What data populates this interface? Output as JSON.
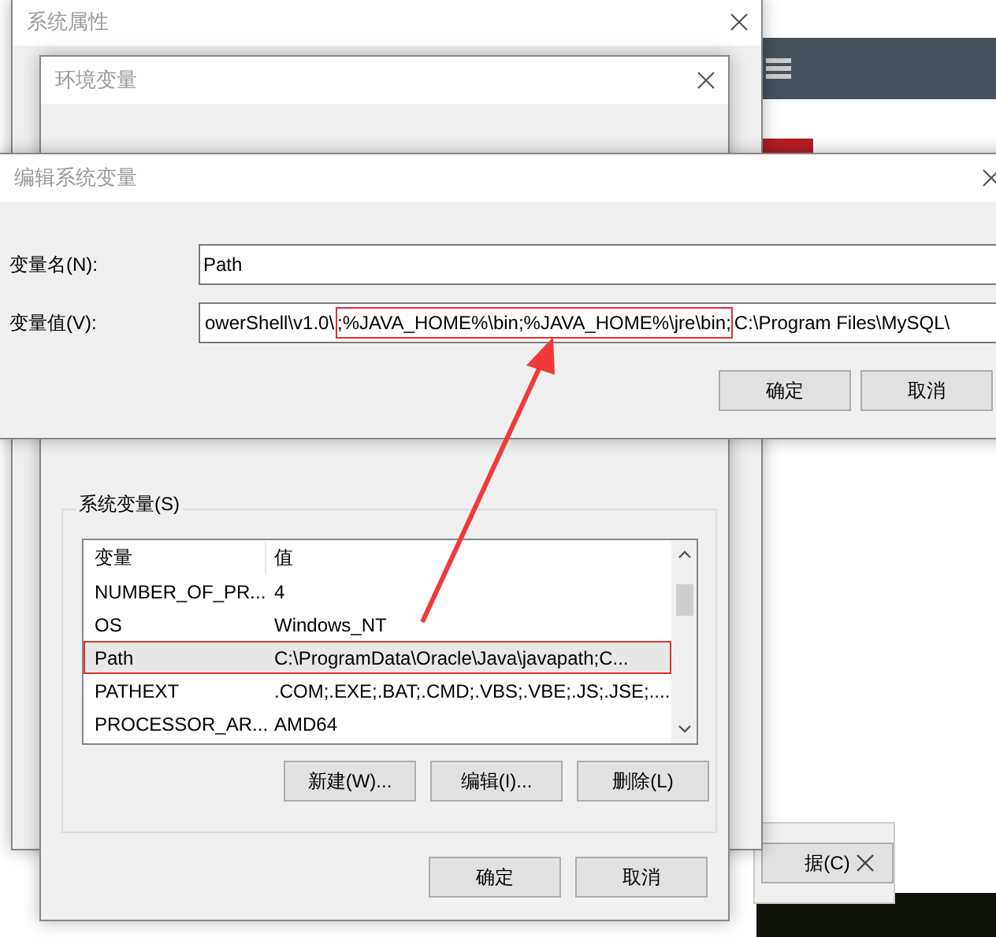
{
  "system_properties_window": {
    "title": "系统属性"
  },
  "environment_variables_window": {
    "title": "环境变量",
    "system_variables": {
      "label": "系统变量(S)",
      "columns": [
        "变量",
        "值"
      ],
      "rows": [
        {
          "name": "NUMBER_OF_PR...",
          "value": "4",
          "selected": false,
          "annotated": false
        },
        {
          "name": "OS",
          "value": "Windows_NT",
          "selected": false,
          "annotated": false
        },
        {
          "name": "Path",
          "value": "C:\\ProgramData\\Oracle\\Java\\javapath;C...",
          "selected": true,
          "annotated": true
        },
        {
          "name": "PATHEXT",
          "value": ".COM;.EXE;.BAT;.CMD;.VBS;.VBE;.JS;.JSE;....",
          "selected": false,
          "annotated": false
        },
        {
          "name": "PROCESSOR_AR...",
          "value": "AMD64",
          "selected": false,
          "annotated": false
        }
      ]
    },
    "list_buttons": [
      "新建(W)...",
      "编辑(I)...",
      "删除(L)"
    ],
    "buttons": [
      "确定",
      "取消"
    ]
  },
  "edit_variable_window": {
    "title": "编辑系统变量",
    "name_label": "变量名(N):",
    "name_value": "Path",
    "value_label": "变量值(V):",
    "value_parts": [
      {
        "text": "owerShell\\v1.0\\",
        "annotated": false
      },
      {
        "text": ";%JAVA_HOME%\\bin;%JAVA_HOME%\\jre\\bin;",
        "annotated": true
      },
      {
        "text": "C:\\Program Files\\MySQL\\",
        "annotated": false
      }
    ],
    "buttons": [
      "确定",
      "取消"
    ]
  },
  "background_window": {
    "button": "据(C)"
  }
}
